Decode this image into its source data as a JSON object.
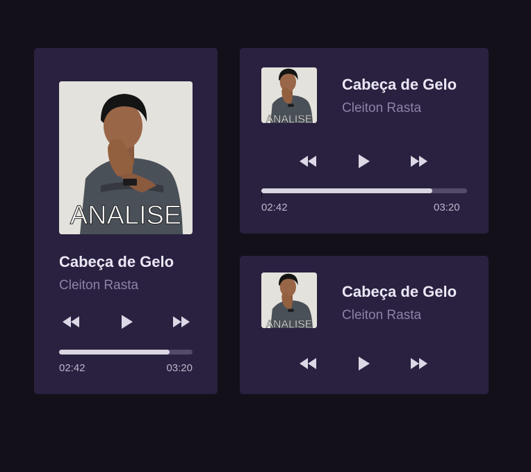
{
  "colors": {
    "page_bg": "#131019",
    "card_bg": "#2a2140",
    "title": "#ece7f6",
    "artist": "#8d83a6",
    "progress_fill": "#d9d5e2",
    "progress_track": "#554a6a"
  },
  "cover": {
    "overlay_text": "ANALISE"
  },
  "players": [
    {
      "title": "Cabeça de Gelo",
      "artist": "Cleiton Rasta",
      "current_time": "02:42",
      "total_time": "03:20",
      "progress": 0.83,
      "controls": [
        "rewind-icon",
        "play-icon",
        "fast-forward-icon"
      ]
    },
    {
      "title": "Cabeça de Gelo",
      "artist": "Cleiton Rasta",
      "current_time": "02:42",
      "total_time": "03:20",
      "progress": 0.83,
      "controls": [
        "rewind-icon",
        "play-icon",
        "fast-forward-icon"
      ]
    },
    {
      "title": "Cabeça de Gelo",
      "artist": "Cleiton Rasta",
      "controls": [
        "rewind-icon",
        "play-icon",
        "fast-forward-icon"
      ]
    }
  ]
}
